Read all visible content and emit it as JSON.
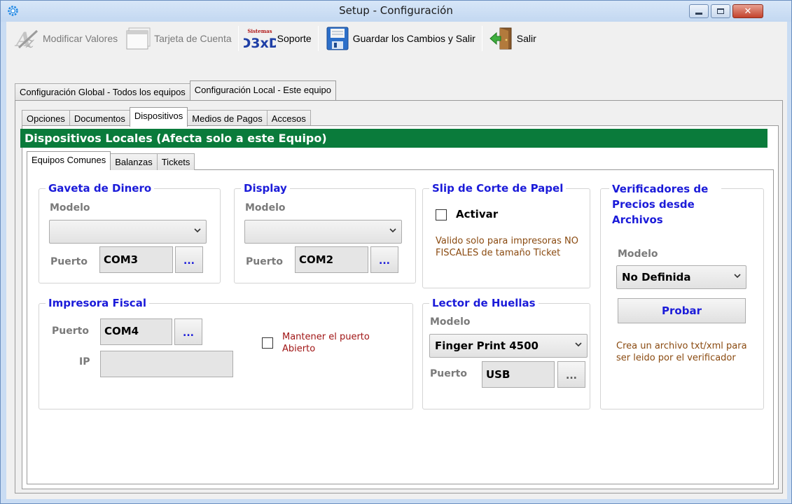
{
  "window": {
    "title": "Setup - Configuración",
    "close_glyph": "✕"
  },
  "toolbar": {
    "modificar_label": "Modificar Valores",
    "tarjeta_label": "Tarjeta de Cuenta",
    "logo_small": "Sistemas",
    "logo_big": "D3xD",
    "soporte_label": "Soporte",
    "guardar_label": "Guardar los Cambios  y Salir",
    "salir_label": "Salir"
  },
  "main_tabs": [
    {
      "label": "Configuración Global - Todos los equipos"
    },
    {
      "label": "Configuración Local - Este equipo"
    }
  ],
  "sub_tabs": [
    {
      "label": "Opciones"
    },
    {
      "label": "Documentos"
    },
    {
      "label": "Dispositivos"
    },
    {
      "label": "Medios de Pagos"
    },
    {
      "label": "Accesos"
    }
  ],
  "section_header": "Dispositivos Locales (Afecta solo a este Equipo)",
  "device_tabs": [
    {
      "label": "Equipos Comunes"
    },
    {
      "label": "Balanzas"
    },
    {
      "label": "Tickets"
    }
  ],
  "gaveta": {
    "title": "Gaveta de Dinero",
    "modelo_label": "Modelo",
    "modelo_value": "",
    "puerto_label": "Puerto",
    "puerto_value": "COM3",
    "dots": "..."
  },
  "display": {
    "title": "Display",
    "modelo_label": "Modelo",
    "modelo_value": "",
    "puerto_label": "Puerto",
    "puerto_value": "COM2",
    "dots": "..."
  },
  "slip": {
    "title": "Slip de Corte de Papel",
    "activar_label": "Activar",
    "activar_checked": false,
    "note": "Valido solo para impresoras NO FISCALES de tamaño Ticket"
  },
  "verificadores": {
    "title": "Verificadores de Precios desde Archivos",
    "modelo_label": "Modelo",
    "modelo_value": "No Definida",
    "probar_label": "Probar",
    "note": "Crea un archivo txt/xml para ser leido por el verificador"
  },
  "impresora": {
    "title": "Impresora Fiscal",
    "puerto_label": "Puerto",
    "puerto_value": "COM4",
    "dots": "...",
    "ip_label": "IP",
    "ip_value": "",
    "mantener_label": "Mantener el puerto Abierto",
    "mantener_checked": false
  },
  "lector": {
    "title": "Lector de Huellas",
    "modelo_label": "Modelo",
    "modelo_value": "Finger Print 4500",
    "puerto_label": "Puerto",
    "puerto_value": "USB",
    "dots": "..."
  },
  "colors": {
    "header_green": "#0a7b3b",
    "group_title_blue": "#1b1bd9",
    "note_brown": "#8a4a10",
    "note_red": "#a01515"
  }
}
